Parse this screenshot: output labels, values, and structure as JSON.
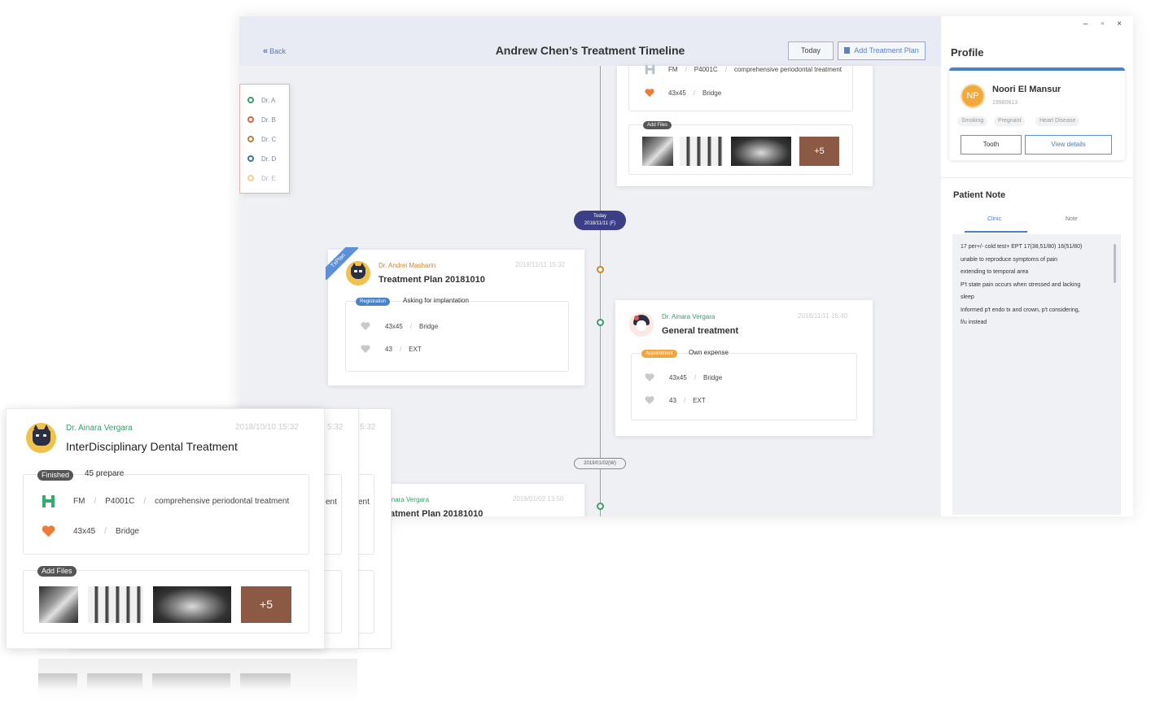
{
  "header": {
    "back_label": "Back",
    "title": "Andrew Chen’s Treatment Timeline",
    "today_label": "Today",
    "add_plan_label": "Add Treatment Plan"
  },
  "legend": [
    {
      "label": "Dr. A",
      "color": "#3a9e6f"
    },
    {
      "label": "Dr. B",
      "color": "#e2643f"
    },
    {
      "label": "Dr. C",
      "color": "#b8823d"
    },
    {
      "label": "Dr. D",
      "color": "#3777a8"
    },
    {
      "label": "Dr. E",
      "color": "#f2b23a"
    }
  ],
  "timeline": {
    "today_label": "Today",
    "today_date": "2018/11/11 (F)",
    "date_pill": "2019/01/02(W)"
  },
  "top_card": {
    "row1": {
      "a": "FM",
      "b": "P4001C",
      "c": "comprehensive periodontal treatment"
    },
    "row2": {
      "a": "43x45",
      "b": "Bridge"
    },
    "add_files": "Add Files",
    "more": "+5"
  },
  "plan_card": {
    "ribbon": "TxPlan",
    "doctor": "Dr. Andrei Masharin",
    "date": "2018/11/11 15:32",
    "title": "Treatment Plan 20181010",
    "tag": "Registration",
    "tag_text": "Asking for implantation",
    "rows": [
      {
        "a": "43x45",
        "b": "Bridge"
      },
      {
        "a": "43",
        "b": "EXT"
      }
    ]
  },
  "general_card": {
    "doctor": "Dr. Ainara Vergara",
    "date": "2018/11/11 16:40",
    "title": "General treatment",
    "tag": "Appointment",
    "tag_text": "Own expense",
    "rows": [
      {
        "a": "43x45",
        "b": "Bridge"
      },
      {
        "a": "43",
        "b": "EXT"
      }
    ]
  },
  "bottom_card": {
    "doctor": "inara Vergara",
    "date": "2019/01/02 13:50",
    "title": "atment Plan 20181010"
  },
  "profile": {
    "heading": "Profile",
    "initials": "NP",
    "name": "Noori El Mansur",
    "id": "19980613",
    "tags": [
      "Smoking",
      "Pregnant",
      "Heart Disease"
    ],
    "tooth_label": "Tooth",
    "view_label": "View details"
  },
  "patient_note": {
    "heading": "Patient Note",
    "tabs": [
      "Clinic",
      "Note"
    ],
    "text": "17 per+/- cold test+ EPT 17(38,51/80) 16(51/80)\nunable to reproduce symptoms of pain\nextending to temporal area\nP't state pain occurs when stressed and lacking\nsleep\nInformed p't endo tx and crown, p't considering,\nf/u instead"
  },
  "front_card": {
    "doctor": "Dr. Ainara Vergara",
    "date": "2018/10/10  15:32",
    "ghost_time": "5:32",
    "title": "InterDisciplinary Dental Treatment",
    "tag": "Finished",
    "tag_text": "45 prepare",
    "row1": {
      "a": "FM",
      "b": "P4001C",
      "c": "comprehensive periodontal treatment"
    },
    "row2": {
      "a": "43x45",
      "b": "Bridge"
    },
    "ghost_frag": "ent",
    "add_files": "Add Files",
    "more": "+5"
  },
  "colors": {
    "accent": "#4a82c8",
    "timeline_today": "#3d3f86",
    "doctor_orange": "#c9862e",
    "doctor_green": "#3b9c6c"
  }
}
